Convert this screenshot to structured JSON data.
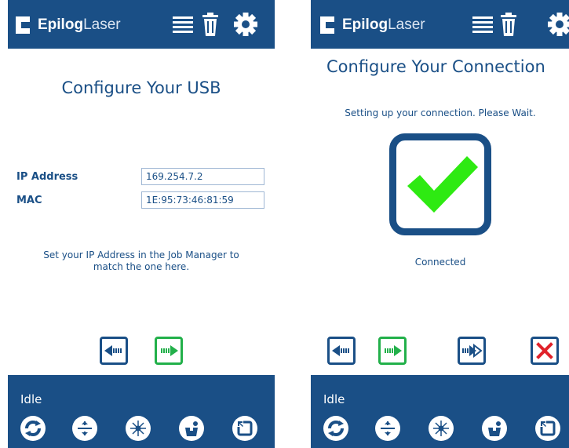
{
  "colors": {
    "brand_blue": "#1a4f86",
    "green": "#22b04a",
    "check_green": "#2eea12",
    "red": "#e0222a"
  },
  "header": {
    "brand_bold": "Epilog",
    "brand_light": "Laser",
    "icons": [
      "menu-icon",
      "trash-icon",
      "gear-icon"
    ]
  },
  "left_screen": {
    "title": "Configure Your USB",
    "ip_label": "IP Address",
    "ip_value": "169.254.7.2",
    "mac_label": "MAC",
    "mac_value": "1E:95:73:46:81:59",
    "message": "Set your IP Address in the Job Manager to match the one here."
  },
  "right_screen": {
    "title": "Configure Your Connection",
    "message": "Setting up your connection. Please Wait.",
    "status_label": "Connected"
  },
  "footer": {
    "status": "Idle",
    "icons": [
      "refresh-icon",
      "jog-icon",
      "laser-icon",
      "focus-icon",
      "home-icon"
    ]
  }
}
